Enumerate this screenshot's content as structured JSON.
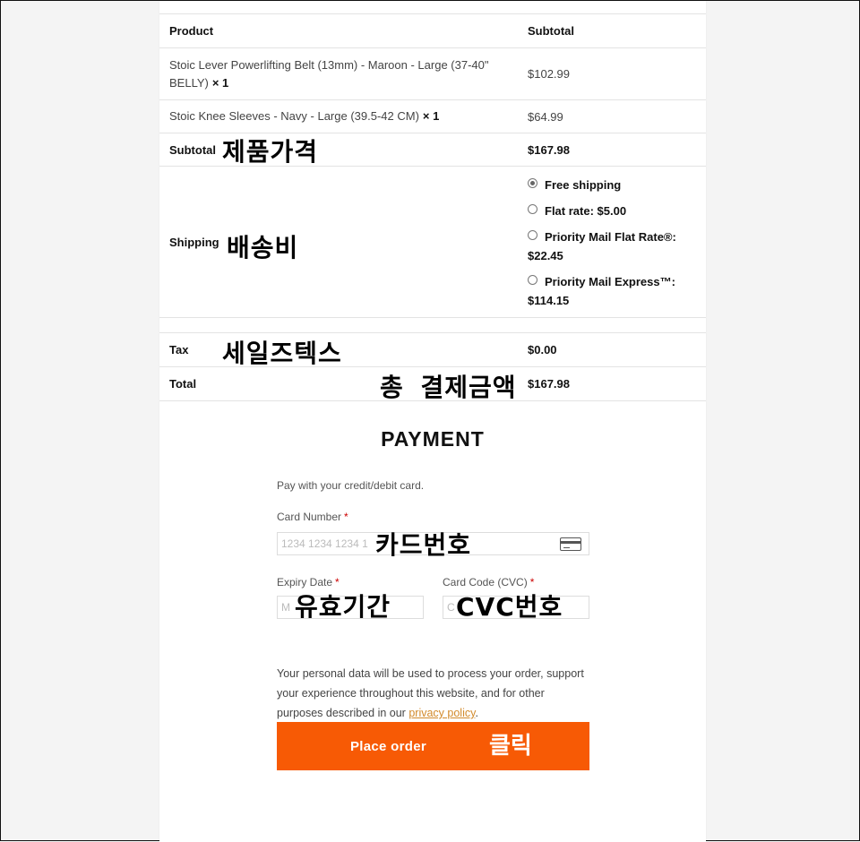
{
  "order_table": {
    "col_product": "Product",
    "col_subtotal": "Subtotal",
    "items": [
      {
        "name": "Stoic Lever Powerlifting Belt (13mm) - Maroon - Large (37-40\" BELLY)",
        "qty": "× 1",
        "price": "$102.99"
      },
      {
        "name": "Stoic Knee Sleeves - Navy - Large (39.5-42 CM)",
        "qty": "× 1",
        "price": "$64.99"
      }
    ],
    "subtotal_label": "Subtotal",
    "subtotal_value": "$167.98",
    "shipping_label": "Shipping",
    "shipping_options": [
      {
        "label": "Free shipping",
        "selected": true
      },
      {
        "label": "Flat rate: $5.00",
        "selected": false
      },
      {
        "label": "Priority Mail Flat Rate®: $22.45",
        "selected": false
      },
      {
        "label": "Priority Mail Express™: $114.15",
        "selected": false
      }
    ],
    "tax_label": "Tax",
    "tax_value": "$0.00",
    "total_label": "Total",
    "total_value": "$167.98"
  },
  "annotations": {
    "subtotal": "제품가격",
    "shipping": "배송비",
    "tax": "세일즈텍스",
    "total": "총 결제금액",
    "card_number": "카드번호",
    "expiry": "유효기간",
    "cvc": "CVC번호",
    "place_order": "클릭"
  },
  "payment": {
    "title": "PAYMENT",
    "subtitle": "Pay with your credit/debit card.",
    "card_number_label": "Card Number",
    "card_number_placeholder": "1234 1234 1234 1",
    "expiry_label": "Expiry Date",
    "expiry_placeholder": "M",
    "cvc_label": "Card Code (CVC)",
    "cvc_placeholder": "C",
    "required_mark": "*",
    "privacy_text": "Your personal data will be used to process your order, support your experience throughout this website, and for other purposes described in our",
    "privacy_link": "privacy policy",
    "privacy_end": ".",
    "place_order_label": "Place order"
  },
  "colors": {
    "button": "#f75a05",
    "link": "#d28a2c",
    "required": "#cc0000"
  },
  "icons": {
    "card": "credit-card-icon",
    "radio": "radio-button"
  }
}
